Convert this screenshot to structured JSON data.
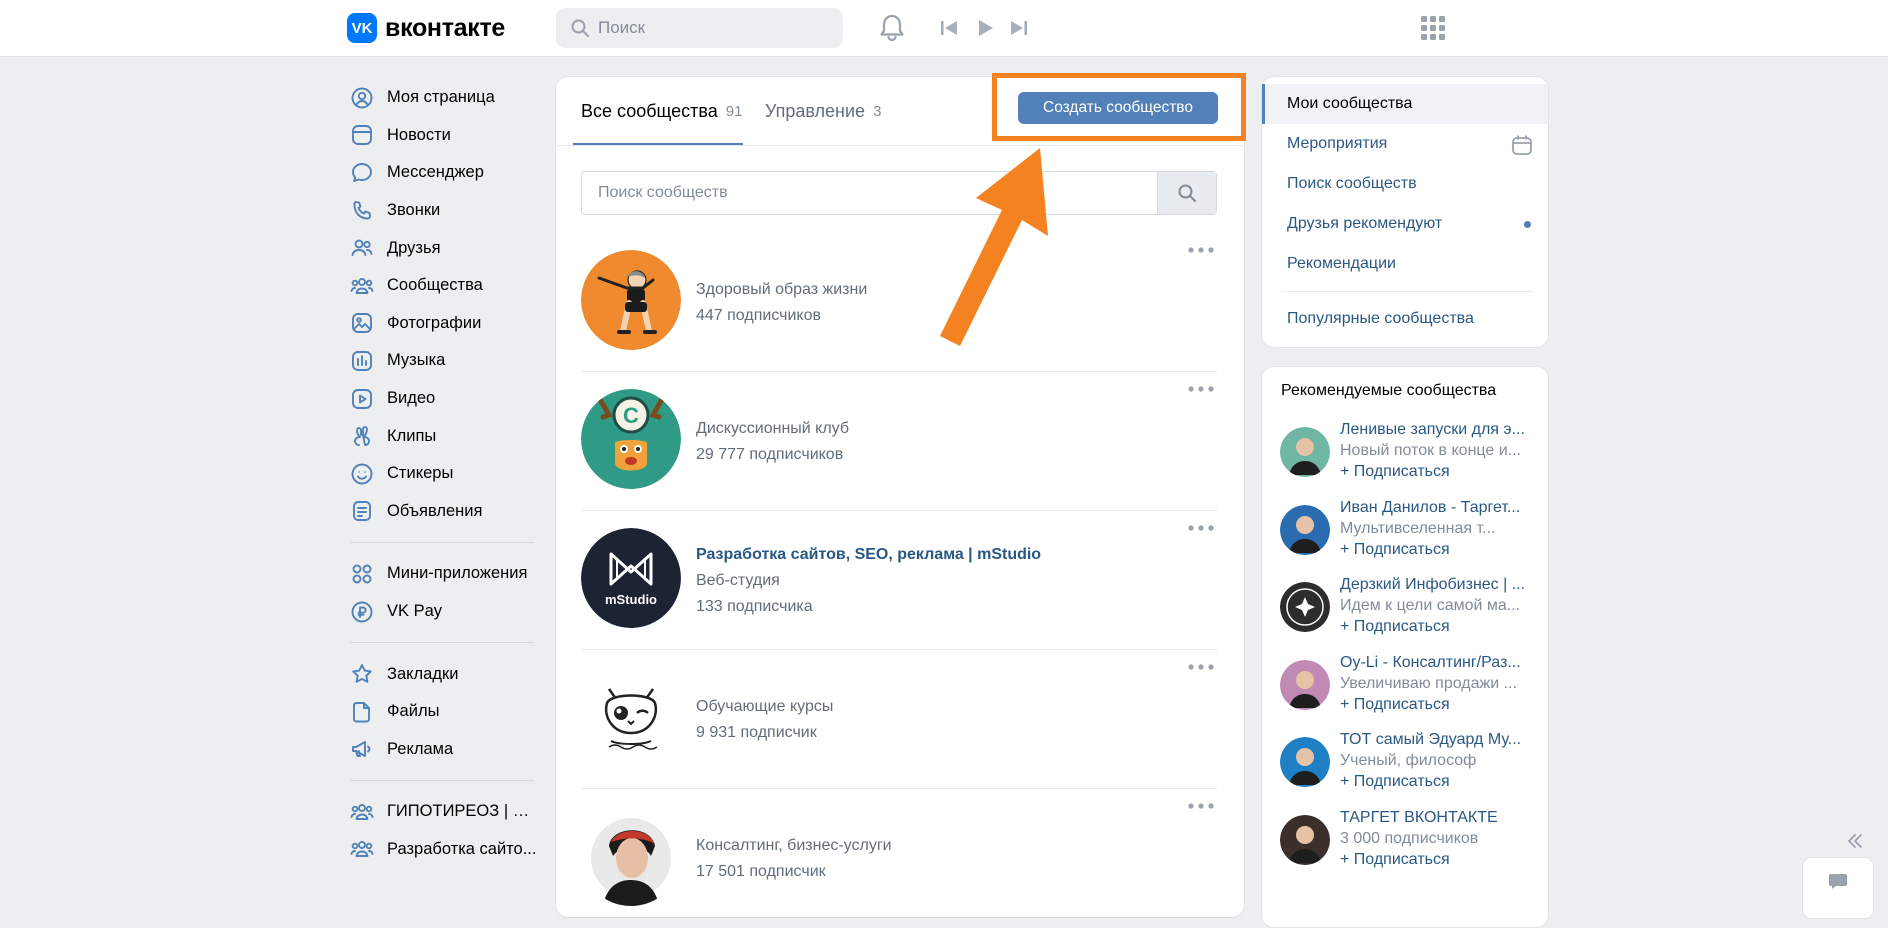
{
  "header": {
    "logo_mark": "VK",
    "logo_text": "вконтакте",
    "search_placeholder": "Поиск"
  },
  "leftnav": {
    "items": [
      {
        "label": "Моя страница",
        "icon": "user-circle-icon"
      },
      {
        "label": "Новости",
        "icon": "news-icon"
      },
      {
        "label": "Мессенджер",
        "icon": "chat-bubble-icon"
      },
      {
        "label": "Звонки",
        "icon": "phone-icon"
      },
      {
        "label": "Друзья",
        "icon": "friends-icon"
      },
      {
        "label": "Сообщества",
        "icon": "communities-icon"
      },
      {
        "label": "Фотографии",
        "icon": "photo-icon"
      },
      {
        "label": "Музыка",
        "icon": "music-icon"
      },
      {
        "label": "Видео",
        "icon": "video-icon"
      },
      {
        "label": "Клипы",
        "icon": "clips-icon"
      },
      {
        "label": "Стикеры",
        "icon": "smile-icon"
      },
      {
        "label": "Объявления",
        "icon": "ads-board-icon"
      }
    ],
    "items2": [
      {
        "label": "Мини-приложения",
        "icon": "mini-apps-icon"
      },
      {
        "label": "VK Pay",
        "icon": "vkpay-icon"
      }
    ],
    "items3": [
      {
        "label": "Закладки",
        "icon": "star-icon"
      },
      {
        "label": "Файлы",
        "icon": "file-icon"
      },
      {
        "label": "Реклама",
        "icon": "megaphone-icon"
      }
    ],
    "items4": [
      {
        "label": "ГИПОТИРЕОЗ | ПО...",
        "icon": "communities-icon"
      },
      {
        "label": "Разработка сайто...",
        "icon": "communities-icon"
      }
    ]
  },
  "main": {
    "tabs": [
      {
        "label": "Все сообщества",
        "count": "91"
      },
      {
        "label": "Управление",
        "count": "3"
      }
    ],
    "create_button": "Создать сообщество",
    "search_placeholder": "Поиск сообществ",
    "groups": [
      {
        "name": "Здоровый образ жизни",
        "subtitle": "",
        "members": "447 подписчиков"
      },
      {
        "name": "Дискуссионный клуб",
        "subtitle": "",
        "members": "29 777 подписчиков"
      },
      {
        "name": "Разработка сайтов, SEO, реклама | mStudio",
        "subtitle": "Веб-студия",
        "members": "133 подписчика"
      },
      {
        "name": "Обучающие курсы",
        "subtitle": "",
        "members": "9 931 подписчик"
      },
      {
        "name": "Консалтинг, бизнес-услуги",
        "subtitle": "",
        "members": "17 501 подписчик"
      }
    ],
    "mstudio_logo_text": "mStudio"
  },
  "rightnav": {
    "items": [
      "Мои сообщества",
      "Мероприятия",
      "Поиск сообществ",
      "Друзья рекомендуют",
      "Рекомендации"
    ],
    "popular": "Популярные сообщества"
  },
  "recommended": {
    "title": "Рекомендуемые сообщества",
    "subscribe_label": "+ Подписаться",
    "items": [
      {
        "name": "Ленивые запуски для э...",
        "desc": "Новый поток в конце и..."
      },
      {
        "name": "Иван Данилов - Таргет...",
        "desc": "Мультивселенная т..."
      },
      {
        "name": "Дерзкий Инфобизнес | ...",
        "desc": "Идем к цели самой ма..."
      },
      {
        "name": "Oy-Li - Консалтинг/Раз...",
        "desc": "Увеличиваю продажи ..."
      },
      {
        "name": "ТОТ самый Эдуард Му...",
        "desc": "Ученый, философ"
      },
      {
        "name": "ТАРГЕТ ВКОНТАКТЕ",
        "desc": "3 000 подписчиков"
      }
    ]
  },
  "colors": {
    "accent": "#5181b8",
    "link": "#2a5885",
    "highlight": "#f58220",
    "vk_blue": "#0077ff"
  }
}
